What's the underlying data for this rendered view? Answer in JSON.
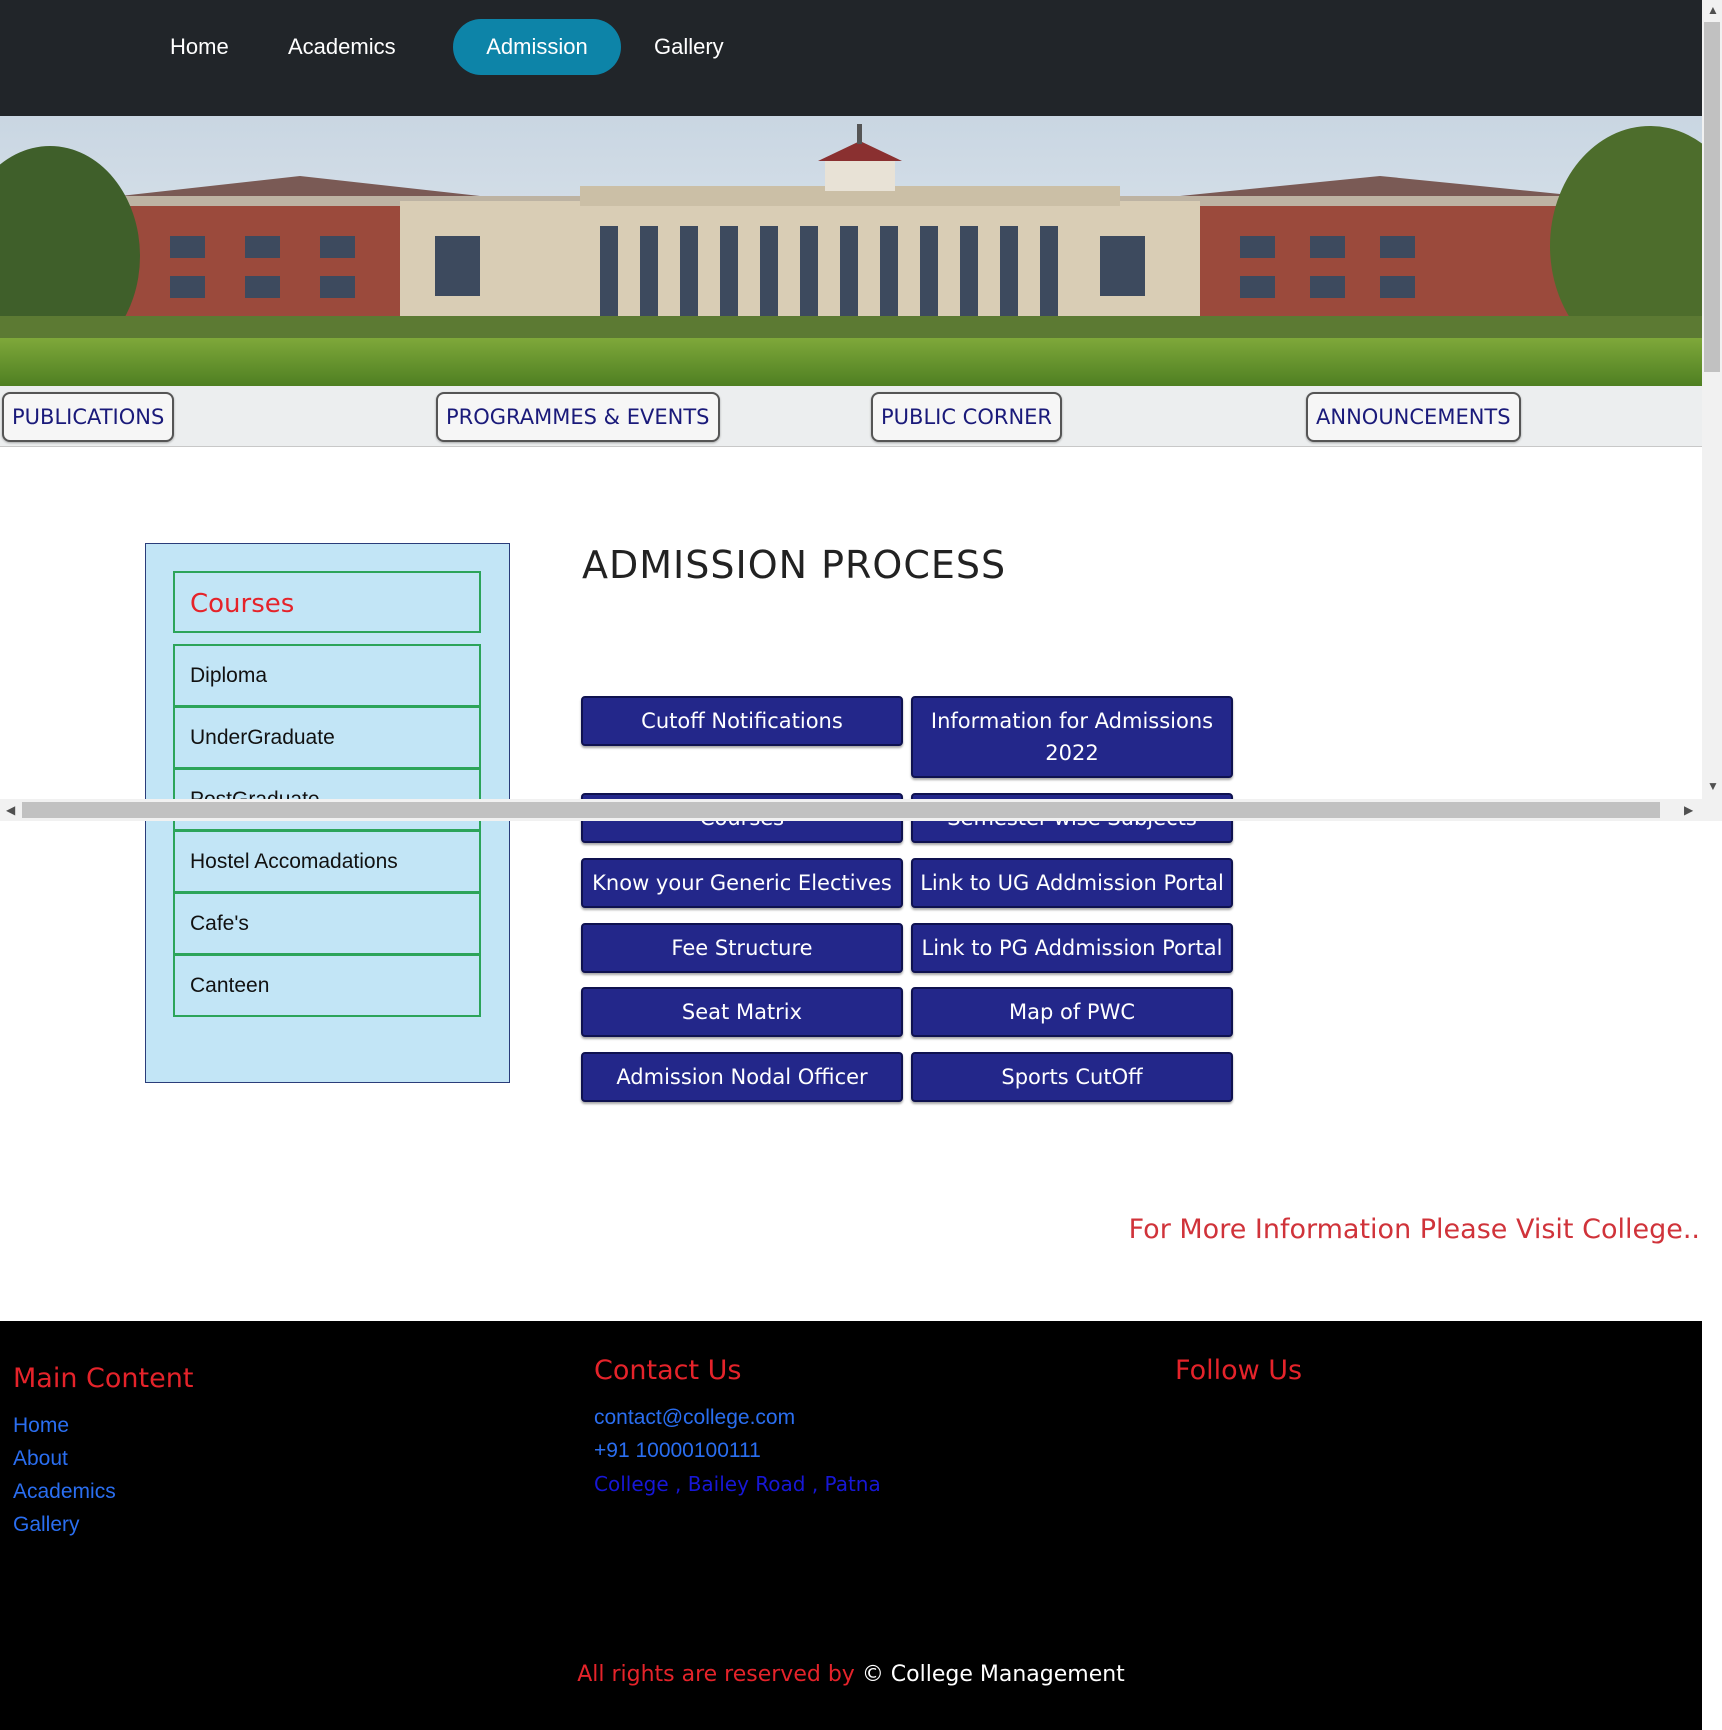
{
  "nav": {
    "items": [
      {
        "label": "Home",
        "active": false
      },
      {
        "label": "Academics",
        "active": false
      },
      {
        "label": "Admission",
        "active": true
      },
      {
        "label": "Gallery",
        "active": false
      }
    ],
    "active_color": "#0d84a8",
    "background": "#212529"
  },
  "subnav": {
    "items": [
      "PUBLICATIONS",
      "PROGRAMMES & EVENTS",
      "PUBLIC CORNER",
      "ANNOUNCEMENTS"
    ]
  },
  "sidebar": {
    "heading": "Courses",
    "items": [
      "Diploma",
      "UnderGraduate",
      "PostGraduate",
      "Hostel Accomadations",
      "Cafe's",
      "Canteen"
    ]
  },
  "main": {
    "title": "ADMISSION PROCESS",
    "buttons": [
      "Cutoff Notifications",
      "Information for Admissions 2022",
      "Courses",
      "Semester-wise Subjects",
      "Know your Generic Electives",
      "Link to UG Addmission Portal",
      "Fee Structure",
      "Link to PG Addmission Portal",
      "Seat Matrix",
      "Map of PWC",
      "Admission Nodal Officer",
      "Sports CutOff"
    ],
    "more_info": "For More Information Please Visit College.."
  },
  "footer": {
    "main_content": {
      "heading": "Main Content",
      "links": [
        "Home",
        "About",
        "Academics",
        "Gallery"
      ]
    },
    "contact": {
      "heading": "Contact Us",
      "email": "contact@college.com",
      "phone": "+91 10000100111",
      "address": "College , Bailey Road , Patna"
    },
    "follow": {
      "heading": "Follow Us"
    },
    "copyright": {
      "prefix": "All rights are reserved by",
      "owner": "© College Management"
    }
  }
}
